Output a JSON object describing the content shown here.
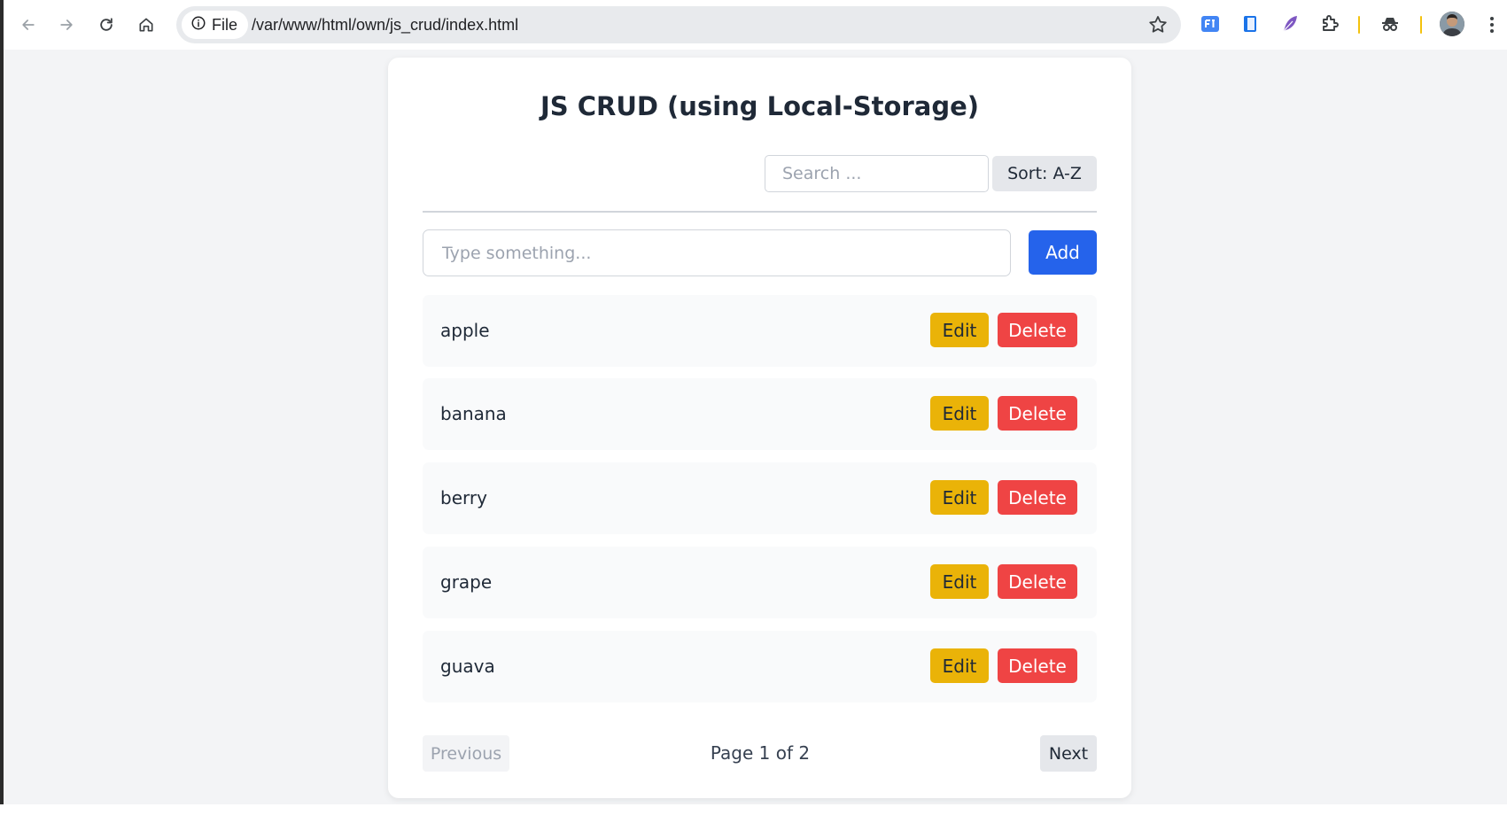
{
  "browser": {
    "file_label": "File",
    "url": "/var/www/html/own/js_crud/index.html",
    "icons": [
      "back-icon",
      "forward-icon",
      "reload-icon",
      "home-icon",
      "info-icon",
      "star-icon",
      "extension-blue-icon",
      "extension-book-icon",
      "extension-feather-icon",
      "puzzle-icon",
      "incognito-icon",
      "avatar",
      "kebab-menu-icon"
    ],
    "separator_color": "#f4c20d"
  },
  "app": {
    "title": "JS CRUD (using Local-Storage)",
    "search_placeholder": "Search ...",
    "search_value": "",
    "sort_label": "Sort: A-Z",
    "input_placeholder": "Type something...",
    "input_value": "",
    "add_label": "Add",
    "items": [
      {
        "text": "apple",
        "edit_label": "Edit",
        "delete_label": "Delete"
      },
      {
        "text": "banana",
        "edit_label": "Edit",
        "delete_label": "Delete"
      },
      {
        "text": "berry",
        "edit_label": "Edit",
        "delete_label": "Delete"
      },
      {
        "text": "grape",
        "edit_label": "Edit",
        "delete_label": "Delete"
      },
      {
        "text": "guava",
        "edit_label": "Edit",
        "delete_label": "Delete"
      }
    ],
    "pagination": {
      "previous_label": "Previous",
      "page_info": "Page 1 of 2",
      "next_label": "Next",
      "previous_disabled": true
    },
    "colors": {
      "add": "#2563eb",
      "edit": "#eab308",
      "delete": "#ef4444",
      "page_bg": "#f3f4f6"
    }
  }
}
